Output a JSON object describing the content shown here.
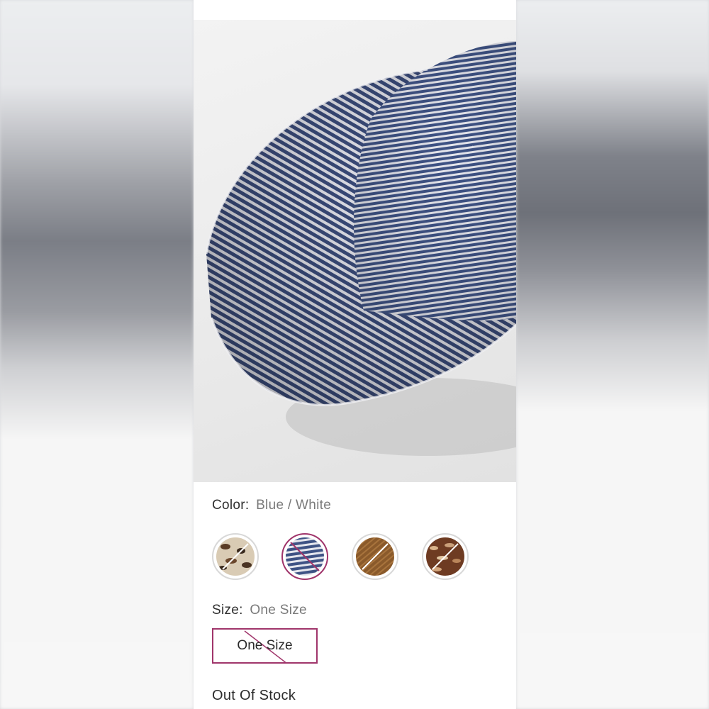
{
  "product": {
    "image_icon": "knit-bucket-hat-photo",
    "color_label": "Color:",
    "color_value": "Blue / White",
    "swatches": [
      {
        "icon": "leopard-swatch",
        "selected": false,
        "unavailable": true
      },
      {
        "icon": "blue-white-swatch",
        "selected": true,
        "unavailable": true
      },
      {
        "icon": "brown-swatch",
        "selected": false,
        "unavailable": true
      },
      {
        "icon": "animal-print-swatch",
        "selected": false,
        "unavailable": true
      }
    ],
    "size_label": "Size:",
    "size_value": "One Size",
    "size_option": "One Size",
    "stock_status": "Out Of Stock"
  },
  "colors": {
    "accent": "#a0356b",
    "hat_blue": "#3b4d7c",
    "hat_white": "#e9e9ee"
  }
}
